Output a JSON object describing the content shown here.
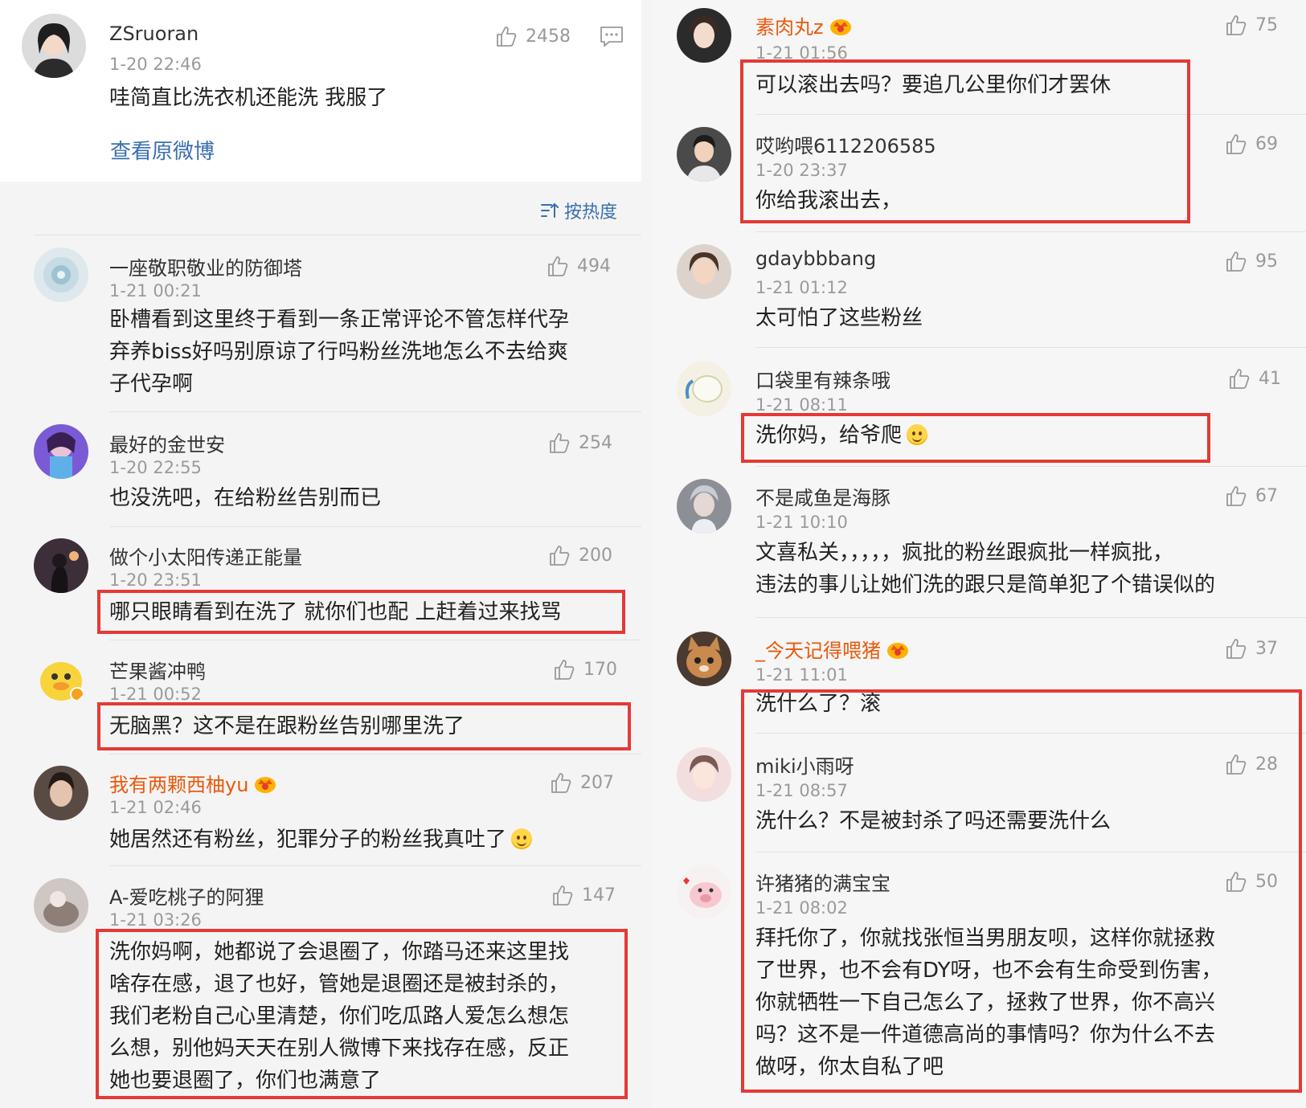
{
  "op": {
    "user": "ZSruoran",
    "time": "1-20 22:46",
    "likes": "2458",
    "text": "哇简直比洗衣机还能洗 我服了",
    "view_original": "查看原微博"
  },
  "sort": {
    "label": "按热度"
  },
  "left_comments": [
    {
      "user": "一座敬职敬业的防御塔",
      "time": "1-21 00:21",
      "likes": "494",
      "lines": [
        "卧槽看到这里终于看到一条正常评论不管怎样代孕",
        "弃养biss好吗别原谅了行吗粉丝洗地怎么不去给爽",
        "子代孕啊"
      ]
    },
    {
      "user": "最好的金世安",
      "time": "1-20 22:55",
      "likes": "254",
      "lines": [
        "也没洗吧，在给粉丝告别而已"
      ]
    },
    {
      "user": "做个小太阳传递正能量",
      "time": "1-20 23:51",
      "likes": "200",
      "lines": [
        "哪只眼睛看到在洗了  就你们也配  上赶着过来找骂"
      ]
    },
    {
      "user": "芒果酱冲鸭",
      "time": "1-21 00:52",
      "likes": "170",
      "lines": [
        "无脑黑？这不是在跟粉丝告别哪里洗了"
      ]
    },
    {
      "user": "我有两颗西柚yu",
      "time": "1-21 02:46",
      "likes": "207",
      "lines": [
        "她居然还有粉丝，犯罪分子的粉丝我真吐了"
      ]
    },
    {
      "user": "A-爱吃桃子的阿狸",
      "time": "1-21 03:26",
      "likes": "147",
      "lines": [
        "洗你妈啊，她都说了会退圈了，你踏马还来这里找",
        "啥存在感，退了也好，管她是退圈还是被封杀的，",
        "我们老粉自己心里清楚，你们吃瓜路人爱怎么想怎",
        "么想，别他妈天天在别人微博下来找存在感，反正",
        "她也要退圈了，你们也满意了"
      ]
    }
  ],
  "right_comments": [
    {
      "user": "素肉丸z",
      "time": "1-21 01:56",
      "likes": "75",
      "lines": [
        "可以滚出去吗？要追几公里你们才罢休"
      ]
    },
    {
      "user": "哎哟喂6112206585",
      "time": "1-20 23:37",
      "likes": "69",
      "lines": [
        "你给我滚出去，"
      ]
    },
    {
      "user": "gdaybbbang",
      "time": "1-21 01:12",
      "likes": "95",
      "lines": [
        "太可怕了这些粉丝"
      ]
    },
    {
      "user": "口袋里有辣条哦",
      "time": "1-21 08:11",
      "likes": "41",
      "lines": [
        "洗你妈，给爷爬"
      ]
    },
    {
      "user": "不是咸鱼是海豚",
      "time": "1-21 10:10",
      "likes": "67",
      "lines": [
        "文喜私关，，，，，疯批的粉丝跟疯批一样疯批，",
        "违法的事儿让她们洗的跟只是简单犯了个错误似的"
      ]
    },
    {
      "user": "_今天记得喂猪",
      "time": "1-21 11:01",
      "likes": "37",
      "lines": [
        "洗什么了？滚"
      ]
    },
    {
      "user": "miki小雨呀",
      "time": "1-21 08:57",
      "likes": "28",
      "lines": [
        "洗什么？不是被封杀了吗还需要洗什么"
      ]
    },
    {
      "user": "许猪猪的满宝宝",
      "time": "1-21 08:02",
      "likes": "50",
      "lines": [
        "拜托你了，你就找张恒当男朋友呗，这样你就拯救",
        "了世界，也不会有DY呀，也不会有生命受到伤害，",
        "你就牺牲一下自己怎么了，拯救了世界，你不高兴",
        "吗？这不是一件道德高尚的事情吗？你为什么不去",
        "做呀，你太自私了吧"
      ]
    }
  ],
  "colors": {
    "vip_name": "#e8590c",
    "link": "#3a6fb0",
    "highlight_box": "#e53935"
  }
}
